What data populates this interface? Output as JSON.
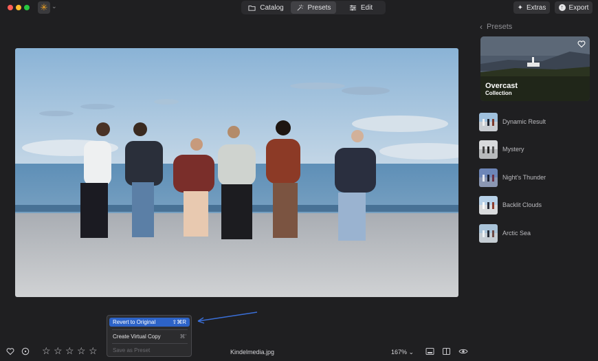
{
  "window": {
    "app_icon": "sparkle-icon"
  },
  "toolbar": {
    "tabs": [
      {
        "label": "Catalog",
        "icon": "folder-icon",
        "active": false
      },
      {
        "label": "Presets",
        "icon": "presets-icon",
        "active": true
      },
      {
        "label": "Edit",
        "icon": "sliders-icon",
        "active": false
      }
    ],
    "extras_label": "Extras",
    "export_label": "Export"
  },
  "presets_panel": {
    "back_label": "Presets",
    "collection": {
      "title": "Overcast",
      "subtitle": "Collection"
    },
    "items": [
      {
        "label": "Dynamic Result"
      },
      {
        "label": "Mystery"
      },
      {
        "label": "Night's Thunder"
      },
      {
        "label": "Backlit Clouds"
      },
      {
        "label": "Arctic Sea"
      }
    ]
  },
  "context_menu": {
    "items": [
      {
        "label": "Revert to Original",
        "shortcut": "⇧⌘R",
        "highlighted": true,
        "enabled": true
      },
      {
        "label": "Create Virtual Copy",
        "shortcut": "⌘'",
        "highlighted": false,
        "enabled": true
      },
      {
        "label": "Save as Preset",
        "shortcut": "",
        "highlighted": false,
        "enabled": false
      }
    ]
  },
  "bottom_bar": {
    "filename": "Kindelmedia.jpg",
    "zoom": "167%",
    "rating": {
      "value": 0,
      "max": 5
    }
  },
  "colors": {
    "accent": "#2d63c8",
    "annotation_arrow": "#3a6fd8",
    "background": "#1f1f21"
  }
}
